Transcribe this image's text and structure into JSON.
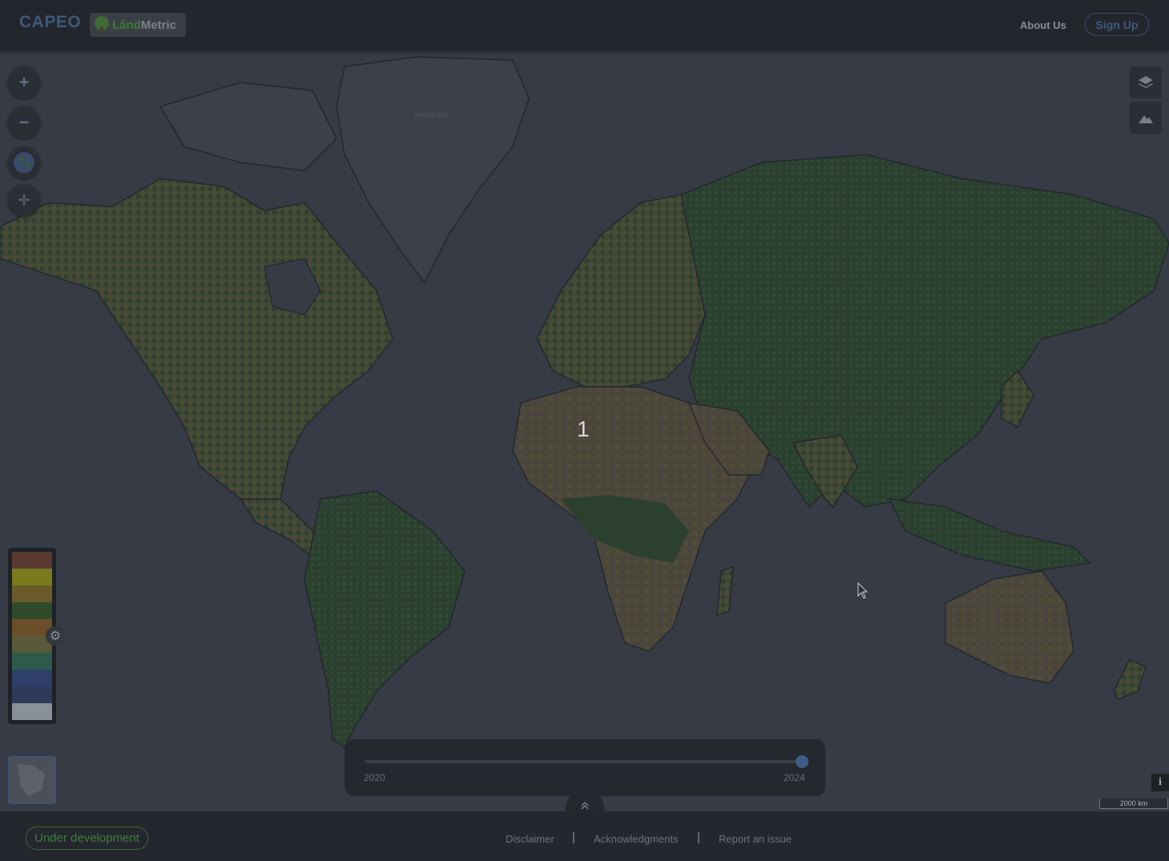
{
  "header": {
    "brand": "CAPEO",
    "logo_text_a": "Lând",
    "logo_text_b": "Metric",
    "about_label": "About Us",
    "signup_label": "Sign Up"
  },
  "map": {
    "cluster_count": "1",
    "greenland_label": "GREENLAND",
    "scale_label": "2000 km",
    "info_label": "i"
  },
  "controls": {
    "zoom_in": "+",
    "zoom_out": "−",
    "center": "✛"
  },
  "legend": {
    "colors": [
      "#5a3a30",
      "#7a7a1e",
      "#6a5a2a",
      "#2f4a28",
      "#6a4e2a",
      "#5a5a3a",
      "#2e5a4e",
      "#2e3f6a",
      "#2e3a5a",
      "#8a9098"
    ]
  },
  "time_slider": {
    "min_label": "2020",
    "max_label": "2024",
    "min": 2020,
    "max": 2024,
    "value": 2024
  },
  "footer": {
    "badge": "Under development",
    "disclaimer": "Disclaimer",
    "acknowledgments": "Acknowledgments",
    "report": "Report an issue",
    "separator": "|"
  },
  "colors": {
    "accent": "#3f5c86",
    "land_green": "#2f4a2b",
    "land_olive": "#5a5a2c",
    "land_tan": "#5d5440",
    "water": "#3d424d"
  }
}
